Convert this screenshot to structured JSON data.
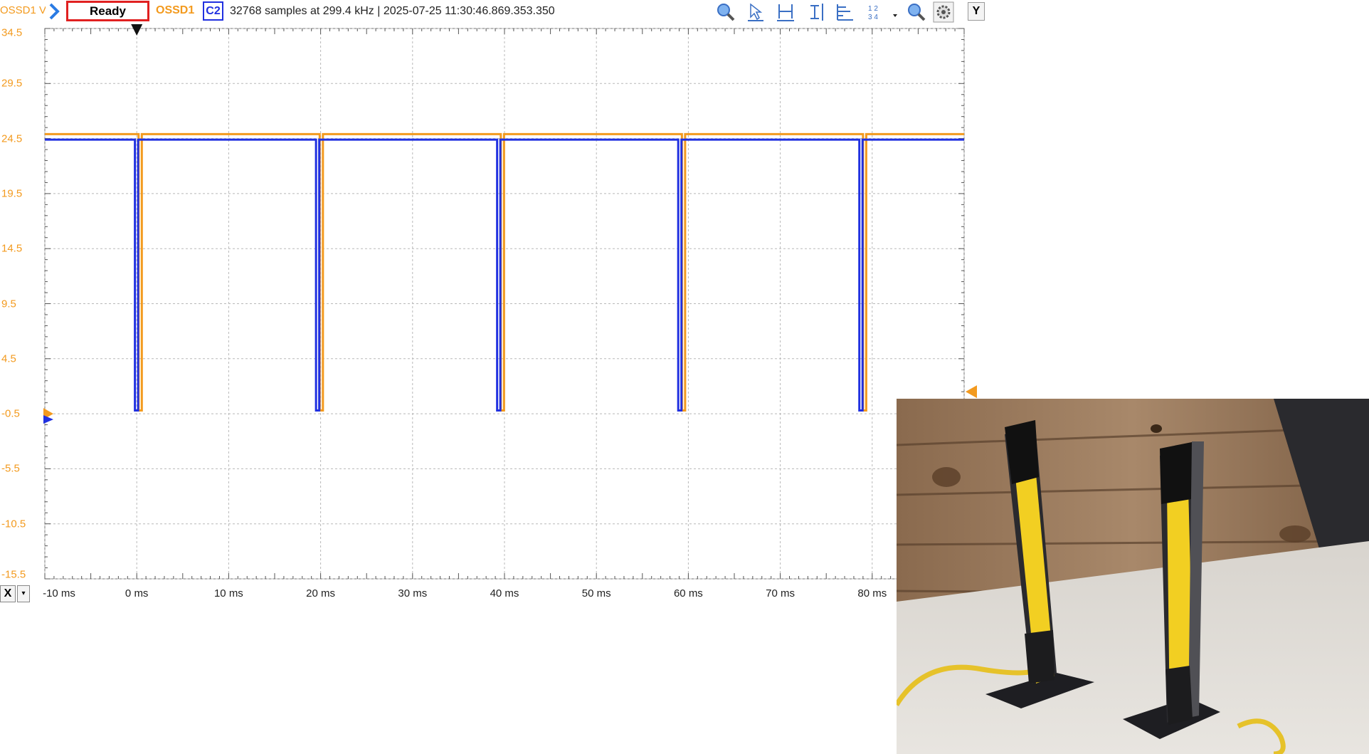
{
  "toolbar": {
    "ch1_label": "OSSD1 V",
    "status": "Ready",
    "ch_a_label": "OSSD1",
    "ch_b_label": "C2",
    "acq_info": "32768 samples at 299.4 kHz  | 2025-07-25 11:30:46.869.353.350",
    "y_button": "Y",
    "icons": [
      "zoom-in-icon",
      "cursor-icon",
      "horizontal-cursor-icon",
      "vertical-cursor-icon",
      "measure-icon",
      "channels-1234-icon",
      "dropdown-icon",
      "zoom-out-icon",
      "settings-icon"
    ]
  },
  "axis": {
    "x_button": "X",
    "x_drop": "▾"
  },
  "colors": {
    "ch_a": "#f39a1e",
    "ch_b": "#2030e0",
    "status_border": "#e02020",
    "grid": "#b8b8b8"
  },
  "chart_data": {
    "type": "line",
    "y_tick_labels": [
      "34.5",
      "29.5",
      "24.5",
      "19.5",
      "14.5",
      "9.5",
      "4.5",
      "-0.5",
      "-5.5",
      "-10.5",
      "-15.5"
    ],
    "x_tick_labels": [
      "-10 ms",
      "0 ms",
      "10 ms",
      "20 ms",
      "30 ms",
      "40 ms",
      "50 ms",
      "60 ms",
      "70 ms",
      "80 ms"
    ],
    "ylim": [
      -15.5,
      34.5
    ],
    "xlim": [
      -10,
      90
    ],
    "grid": true,
    "series": [
      {
        "name": "OSSD1",
        "color": "#f39a1e",
        "high": 24.9,
        "low": -0.2,
        "pulse_times_ms": [
          0.2,
          19.9,
          39.6,
          59.3,
          79.0
        ],
        "pulse_width_ms": 0.35
      },
      {
        "name": "C2",
        "color": "#2030e0",
        "high": 24.4,
        "low": -0.2,
        "pulse_times_ms": [
          -0.2,
          19.5,
          39.2,
          58.9,
          78.6
        ],
        "pulse_width_ms": 0.35
      }
    ]
  }
}
